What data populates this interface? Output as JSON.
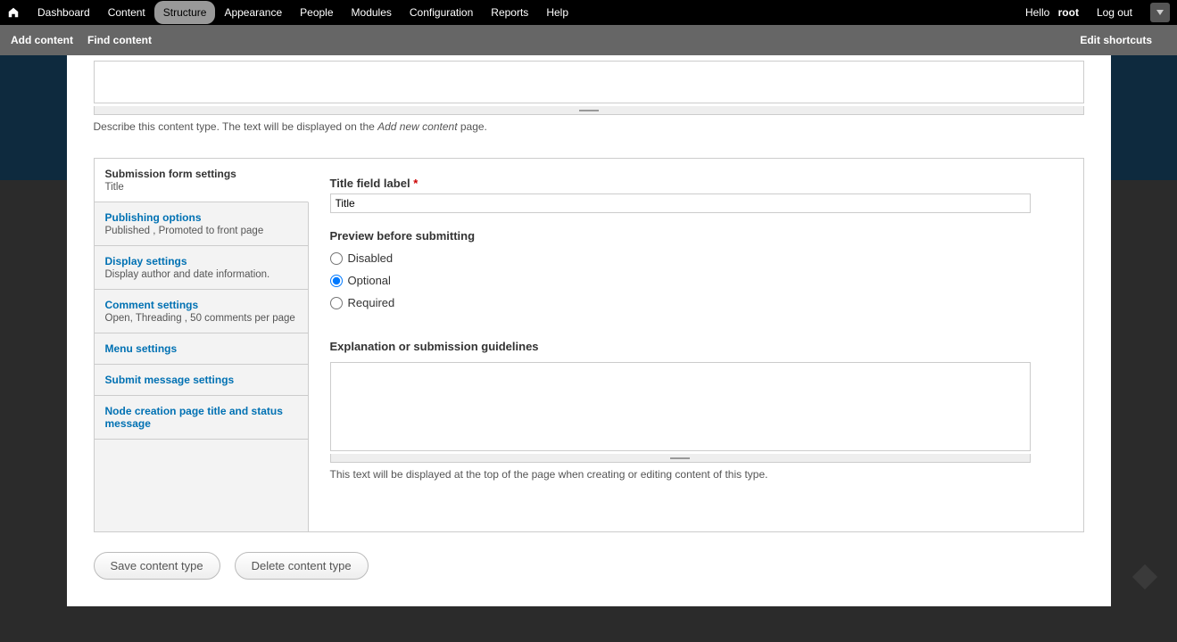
{
  "toolbar": {
    "items": [
      "Dashboard",
      "Content",
      "Structure",
      "Appearance",
      "People",
      "Modules",
      "Configuration",
      "Reports",
      "Help"
    ],
    "active": "Structure",
    "hello_prefix": "Hello ",
    "username": "root",
    "logout": "Log out"
  },
  "shortcut": {
    "add_content": "Add content",
    "find_content": "Find content",
    "edit_shortcuts": "Edit shortcuts"
  },
  "description": {
    "help_before": "Describe this content type. The text will be displayed on the ",
    "help_em": "Add new content",
    "help_after": " page."
  },
  "vtabs": [
    {
      "id": "submission",
      "title": "Submission form settings",
      "summary": "Title"
    },
    {
      "id": "publishing",
      "title": "Publishing options",
      "summary": "Published , Promoted to front page"
    },
    {
      "id": "display",
      "title": "Display settings",
      "summary": "Display author and date information."
    },
    {
      "id": "comment",
      "title": "Comment settings",
      "summary": "Open, Threading , 50 comments per page"
    },
    {
      "id": "menu",
      "title": "Menu settings",
      "summary": ""
    },
    {
      "id": "submit_msg",
      "title": "Submit message settings",
      "summary": ""
    },
    {
      "id": "node_creation",
      "title": "Node creation page title and status message",
      "summary": ""
    }
  ],
  "form": {
    "title_field_label_label": "Title field label",
    "title_field_value": "Title",
    "preview_label": "Preview before submitting",
    "preview_options": {
      "disabled": "Disabled",
      "optional": "Optional",
      "required": "Required"
    },
    "preview_selected": "optional",
    "explanation_label": "Explanation or submission guidelines",
    "explanation_help": "This text will be displayed at the top of the page when creating or editing content of this type."
  },
  "buttons": {
    "save": "Save content type",
    "delete": "Delete content type"
  }
}
